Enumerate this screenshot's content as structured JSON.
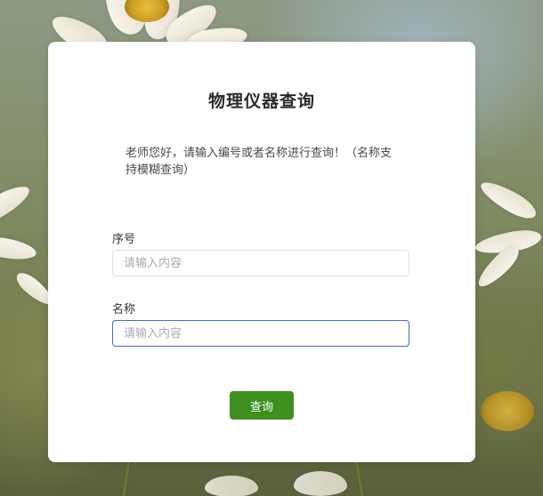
{
  "page": {
    "title": "物理仪器查询",
    "hint": "老师您好，请输入编号或者名称进行查询！（名称支持模糊查询）"
  },
  "form": {
    "serial": {
      "label": "序号",
      "placeholder": "请输入内容",
      "value": ""
    },
    "name": {
      "label": "名称",
      "placeholder": "请输入内容",
      "value": "",
      "focused": true
    },
    "submit_label": "查询"
  },
  "colors": {
    "button": "#3f8f1e",
    "focus_border": "#3a6fc4",
    "card": "#ffffff"
  }
}
